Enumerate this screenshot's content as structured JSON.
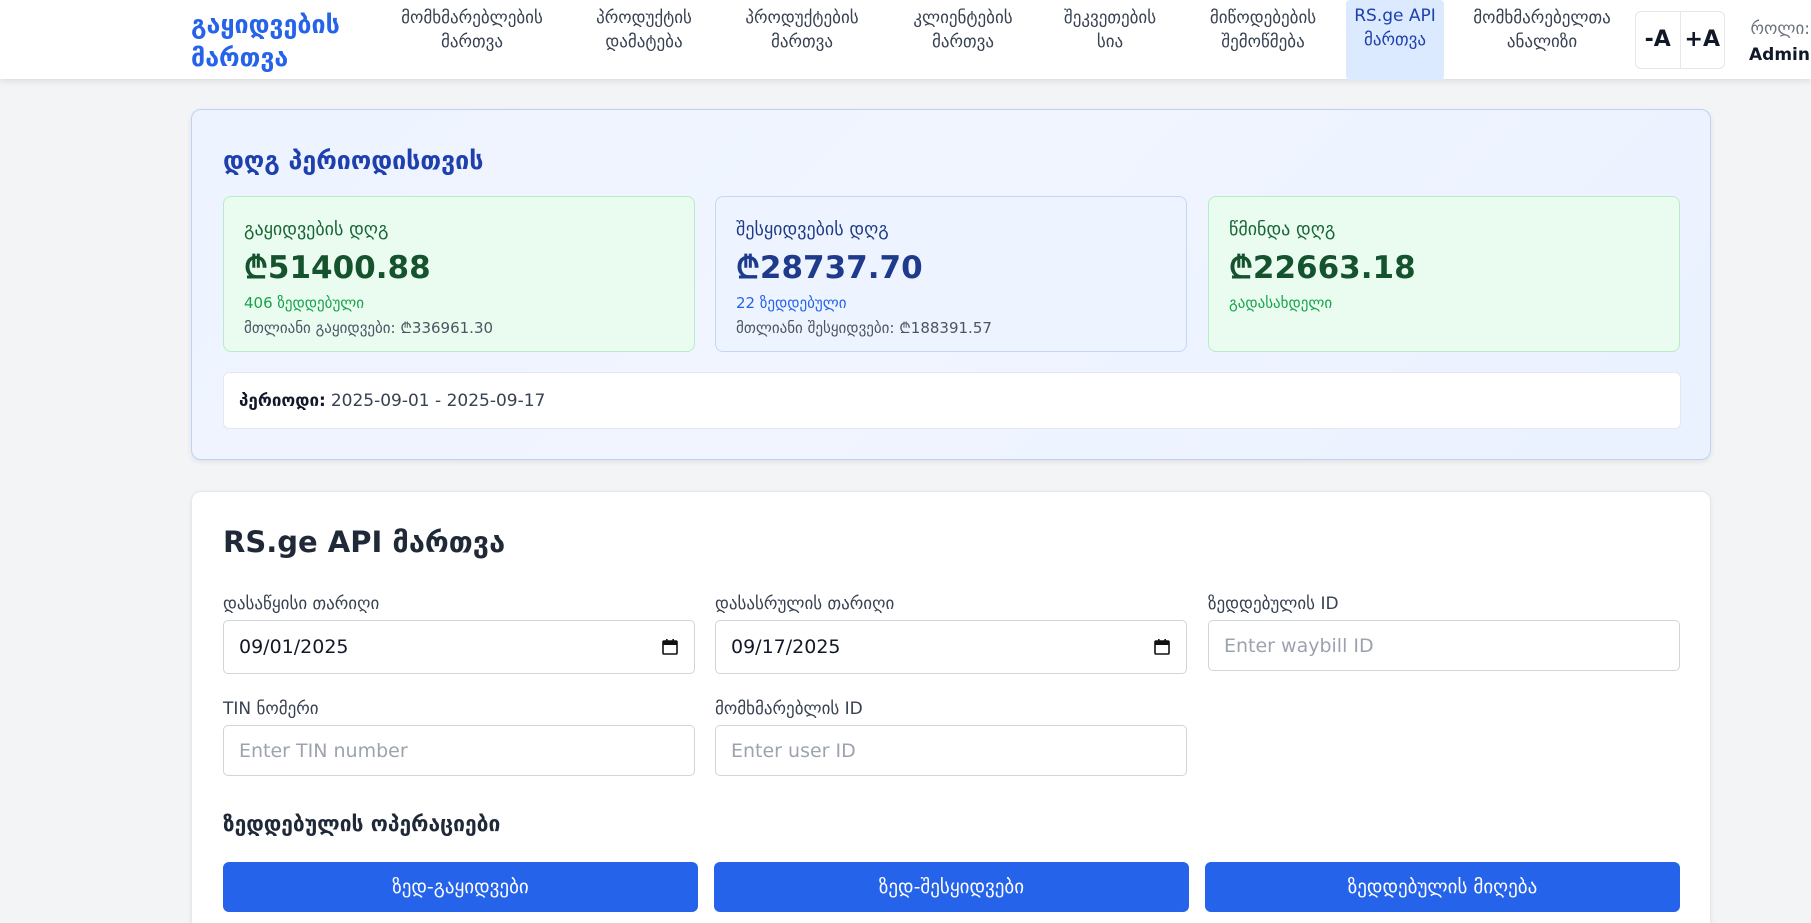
{
  "header": {
    "brand": "გაყიდვების მართვა",
    "nav": [
      {
        "label": "მომხმარებლების მართვა"
      },
      {
        "label": "პროდუქტის დამატება"
      },
      {
        "label": "პროდუქტების მართვა"
      },
      {
        "label": "კლიენტების მართვა"
      },
      {
        "label": "შეკვეთების სია"
      },
      {
        "label": "მიწოდებების შემოწმება"
      },
      {
        "label": "RS.ge API მართვა",
        "active": true
      },
      {
        "label": "მომხმარებელთა ანალიზი"
      }
    ],
    "font_decrease": "-A",
    "font_increase": "+A",
    "role_label": "როლი:",
    "role_value": "Admin"
  },
  "profit": {
    "title": "დღგ პერიოდისთვის",
    "cards": [
      {
        "label": "გაყიდვების დღგ",
        "value": "₾51400.88",
        "sub": "406 ზედდებული",
        "sub2": "მთლიანი გაყიდვები: ₾336961.30",
        "color": "#16a34a"
      },
      {
        "label": "შესყიდვების დღგ",
        "value": "₾28737.70",
        "sub": "22 ზედდებული",
        "sub2": "მთლიანი შესყიდვები: ₾188391.57",
        "color": "#2563eb"
      },
      {
        "label": "წმინდა დღგ",
        "value": "₾22663.18",
        "sub": "გადასახდელი",
        "sub2": "",
        "color": "#16a34a"
      }
    ],
    "period_label": "პერიოდი:",
    "period_value": "2025-09-01 - 2025-09-17"
  },
  "api": {
    "title": "RS.ge API მართვა",
    "start_date_label": "დასაწყისი თარიღი",
    "start_date_value": "09/01/2025",
    "end_date_label": "დასასრულის თარიღი",
    "end_date_value": "09/17/2025",
    "waybill_label": "ზედდებულის ID",
    "waybill_placeholder": "Enter waybill ID",
    "tin_label": "TIN ნომერი",
    "tin_placeholder": "Enter TIN number",
    "user_label": "მომხმარებლის ID",
    "user_placeholder": "Enter user ID",
    "ops_title": "ზედდებულის ოპერაციები",
    "buttons": [
      "ზედ-გაყიდვები",
      "ზედ-შესყიდვები",
      "ზედდებულის მიღება"
    ]
  },
  "colors": {
    "accent": "#2563eb",
    "success": "#16a34a"
  }
}
